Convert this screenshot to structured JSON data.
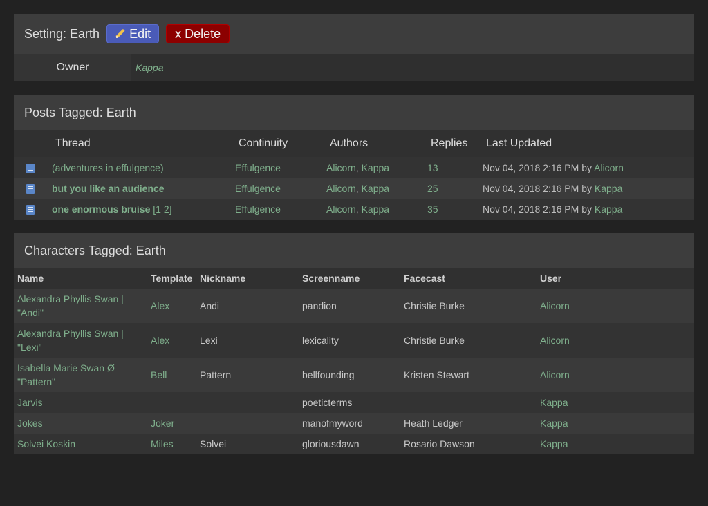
{
  "setting": {
    "title": "Setting: Earth",
    "edit_label": "Edit",
    "delete_label": "x Delete",
    "owner_label": "Owner",
    "owner_value": "Kappa"
  },
  "posts": {
    "title": "Posts Tagged: Earth",
    "columns": [
      "Thread",
      "Continuity",
      "Authors",
      "Replies",
      "Last Updated"
    ],
    "rows": [
      {
        "thread": "(adventures in effulgence)",
        "bold": false,
        "pages": "",
        "continuity": "Effulgence",
        "author1": "Alicorn",
        "author2": "Kappa",
        "replies": "13",
        "updated": "Nov 04, 2018 2:16 PM by",
        "updated_by": "Alicorn"
      },
      {
        "thread": "but you like an audience",
        "bold": true,
        "pages": "",
        "continuity": "Effulgence",
        "author1": "Alicorn",
        "author2": "Kappa",
        "replies": "25",
        "updated": "Nov 04, 2018 2:16 PM by",
        "updated_by": "Kappa"
      },
      {
        "thread": "one enormous bruise",
        "bold": true,
        "pages": "[1 2]",
        "continuity": "Effulgence",
        "author1": "Alicorn",
        "author2": "Kappa",
        "replies": "35",
        "updated": "Nov 04, 2018 2:16 PM by",
        "updated_by": "Kappa"
      }
    ]
  },
  "characters": {
    "title": "Characters Tagged: Earth",
    "columns": [
      "Name",
      "Template",
      "Nickname",
      "Screenname",
      "Facecast",
      "User"
    ],
    "rows": [
      {
        "name": "Alexandra Phyllis Swan | \"Andi\"",
        "template": "Alex",
        "nickname": "Andi",
        "screenname": "pandion",
        "facecast": "Christie Burke",
        "user": "Alicorn"
      },
      {
        "name": "Alexandra Phyllis Swan | \"Lexi\"",
        "template": "Alex",
        "nickname": "Lexi",
        "screenname": "lexicality",
        "facecast": "Christie Burke",
        "user": "Alicorn"
      },
      {
        "name": "Isabella Marie Swan Ø \"Pattern\"",
        "template": "Bell",
        "nickname": "Pattern",
        "screenname": "bellfounding",
        "facecast": "Kristen Stewart",
        "user": "Alicorn"
      },
      {
        "name": "Jarvis",
        "template": "",
        "nickname": "",
        "screenname": "poeticterms",
        "facecast": "",
        "user": "Kappa"
      },
      {
        "name": "Jokes",
        "template": "Joker",
        "nickname": "",
        "screenname": "manofmyword",
        "facecast": "Heath Ledger",
        "user": "Kappa"
      },
      {
        "name": "Solvei Koskin",
        "template": "Miles",
        "nickname": "Solvei",
        "screenname": "gloriousdawn",
        "facecast": "Rosario Dawson",
        "user": "Kappa"
      }
    ]
  }
}
